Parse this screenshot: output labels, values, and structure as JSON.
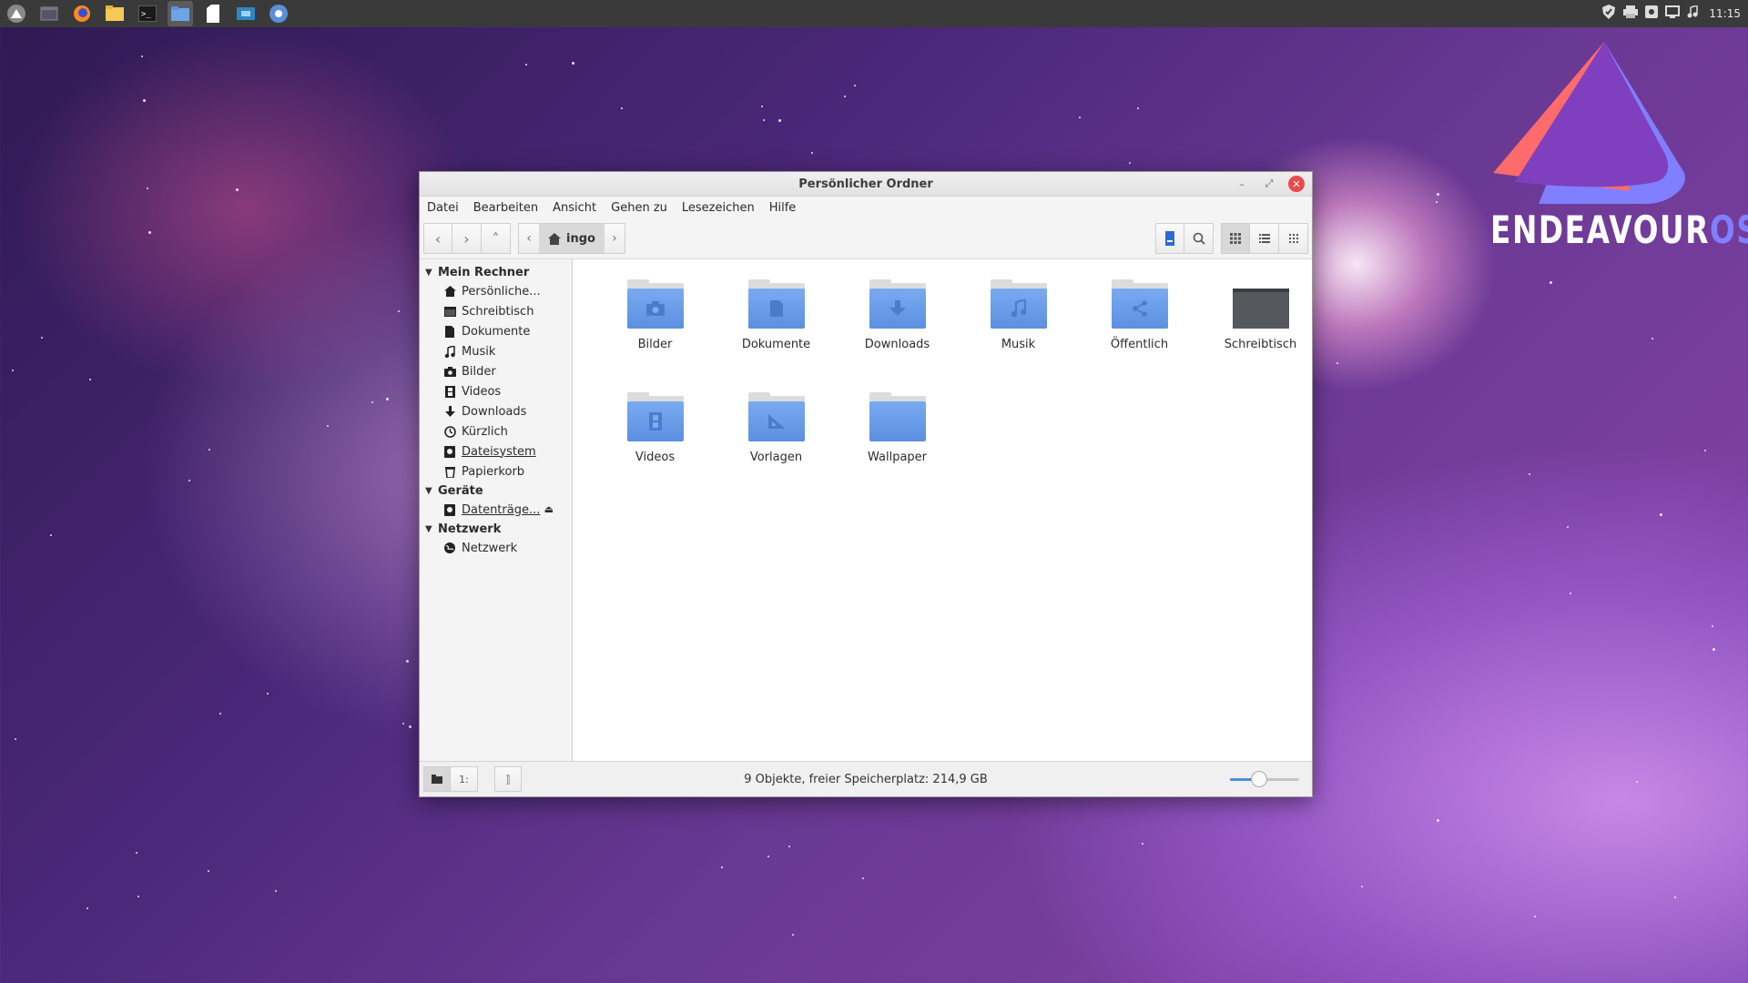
{
  "panel": {
    "launchers": [
      "endeavouros-icon",
      "window-icon",
      "firefox-icon",
      "file-manager-icon",
      "terminal-icon",
      "folder-icon",
      "paper-icon",
      "screenshot-icon",
      "chromium-icon"
    ],
    "clock": "11:15"
  },
  "desktop": {
    "logo_text_main": "ENDEAVOUR",
    "logo_text_suffix": "OS",
    "logo_colors": {
      "red": "#ff6b6b",
      "purple": "#7f3fbf",
      "blue": "#7f7fff"
    }
  },
  "window": {
    "title": "Persönlicher Ordner",
    "menu": [
      "Datei",
      "Bearbeiten",
      "Ansicht",
      "Gehen zu",
      "Lesezeichen",
      "Hilfe"
    ],
    "breadcrumb": "ingo",
    "sidebar": {
      "sections": [
        {
          "label": "Mein Rechner",
          "items": [
            {
              "label": "Persönliche...",
              "icon": "home-icon"
            },
            {
              "label": "Schreibtisch",
              "icon": "desktop-icon"
            },
            {
              "label": "Dokumente",
              "icon": "document-icon"
            },
            {
              "label": "Musik",
              "icon": "music-icon"
            },
            {
              "label": "Bilder",
              "icon": "camera-icon"
            },
            {
              "label": "Videos",
              "icon": "film-icon"
            },
            {
              "label": "Downloads",
              "icon": "download-icon"
            },
            {
              "label": "Kürzlich",
              "icon": "clock-icon"
            },
            {
              "label": "Dateisystem",
              "icon": "drive-icon"
            },
            {
              "label": "Papierkorb",
              "icon": "trash-icon"
            }
          ]
        },
        {
          "label": "Geräte",
          "items": [
            {
              "label": "Datenträge...",
              "icon": "drive-icon"
            }
          ]
        },
        {
          "label": "Netzwerk",
          "items": [
            {
              "label": "Netzwerk",
              "icon": "network-icon"
            }
          ]
        }
      ]
    },
    "files": [
      {
        "name": "Bilder",
        "icon": "camera-icon"
      },
      {
        "name": "Dokumente",
        "icon": "document-icon"
      },
      {
        "name": "Downloads",
        "icon": "download-icon"
      },
      {
        "name": "Musik",
        "icon": "music-icon"
      },
      {
        "name": "Öffentlich",
        "icon": "share-icon"
      },
      {
        "name": "Schreibtisch",
        "icon": "desktop-icon"
      },
      {
        "name": "Videos",
        "icon": "film-icon"
      },
      {
        "name": "Vorlagen",
        "icon": "template-icon"
      },
      {
        "name": "Wallpaper",
        "icon": "folder-icon"
      }
    ],
    "status": "9 Objekte, freier Speicherplatz: 214,9 GB",
    "zoom_level": 0.42,
    "accent": "#5b8fe0"
  }
}
